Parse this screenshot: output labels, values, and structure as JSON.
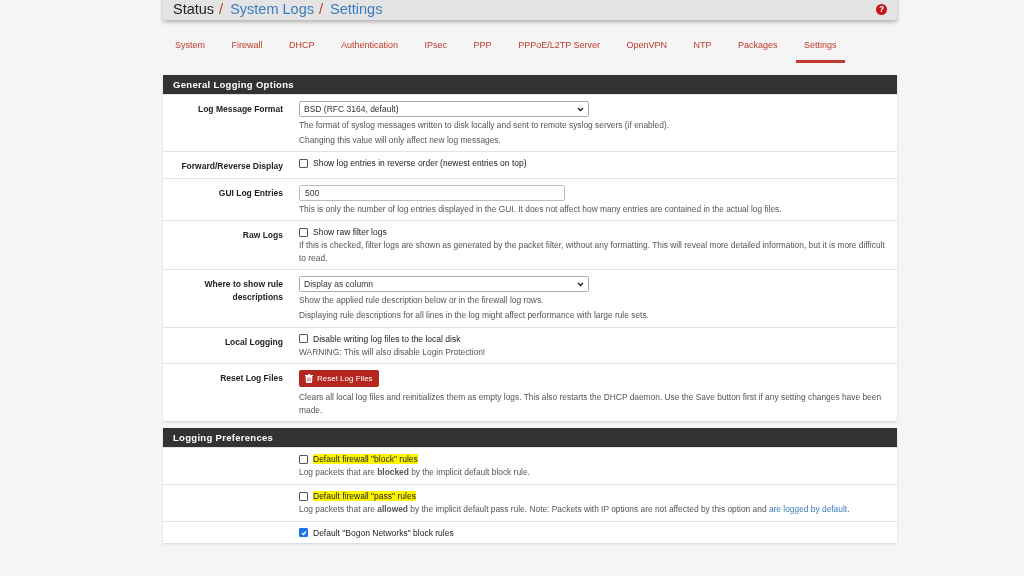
{
  "breadcrumb": {
    "items": [
      {
        "text": "Status",
        "link": false
      },
      {
        "text": "System Logs",
        "link": true
      },
      {
        "text": "Settings",
        "link": true
      }
    ],
    "separator": "/",
    "help": "?"
  },
  "tabs": [
    {
      "label": "System",
      "selected": false
    },
    {
      "label": "Firewall",
      "selected": false
    },
    {
      "label": "DHCP",
      "selected": false
    },
    {
      "label": "Authentication",
      "selected": false
    },
    {
      "label": "IPsec",
      "selected": false
    },
    {
      "label": "PPP",
      "selected": false
    },
    {
      "label": "PPPoE/L2TP Server",
      "selected": false
    },
    {
      "label": "OpenVPN",
      "selected": false
    },
    {
      "label": "NTP",
      "selected": false
    },
    {
      "label": "Packages",
      "selected": false
    },
    {
      "label": "Settings",
      "selected": true
    }
  ],
  "panels": [
    {
      "title": "General Logging Options",
      "rows": [
        {
          "label": "Log Message Format",
          "kind": "select",
          "value": "BSD (RFC 3164, default)",
          "help": [
            {
              "text": "The format of syslog messages written to disk locally and sent to remote syslog servers (if enabled)."
            },
            {
              "text": "Changing this value will only affect new log messages."
            }
          ]
        },
        {
          "label": "Forward/Reverse Display",
          "kind": "checkbox",
          "checked": false,
          "highlighted": false,
          "text": "Show log entries in reverse order (newest entries on top)",
          "help": []
        },
        {
          "label": "GUI Log Entries",
          "kind": "input",
          "value": "500",
          "help": [
            {
              "text": "This is only the number of log entries displayed in the GUI. It does not affect how many entries are contained in the actual log files."
            }
          ]
        },
        {
          "label": "Raw Logs",
          "kind": "checkbox",
          "checked": false,
          "highlighted": false,
          "text": "Show raw filter logs",
          "help": [
            {
              "text": "If this is checked, filter logs are shown as generated by the packet filter, without any formatting. This will reveal more detailed information, but it is more difficult to read."
            }
          ]
        },
        {
          "label": "Where to show rule descriptions",
          "kind": "select",
          "value": "Display as column",
          "help": [
            {
              "text": "Show the applied rule description below or in the firewall log rows."
            },
            {
              "text": "Displaying rule descriptions for all lines in the log might affect performance with large rule sets."
            }
          ]
        },
        {
          "label": "Local Logging",
          "kind": "checkbox",
          "checked": false,
          "highlighted": false,
          "text": "Disable writing log files to the local disk",
          "help": [
            {
              "text": "WARNING: This will also disable Login Protection!"
            }
          ]
        },
        {
          "label": "Reset Log Files",
          "kind": "button",
          "text": "Reset Log Files",
          "help": [
            {
              "text": "Clears all local log files and reinitializes them as empty logs. This also restarts the DHCP daemon. Use the Save button first if any setting changes have been made."
            }
          ]
        }
      ]
    },
    {
      "title": "Logging Preferences",
      "rows": [
        {
          "label": "",
          "kind": "checkbox",
          "checked": false,
          "highlighted": true,
          "text": "Default firewall \"block\" rules",
          "help": [
            {
              "text": "Log packets that are **blocked** by the implicit default block rule."
            }
          ]
        },
        {
          "label": "",
          "kind": "checkbox",
          "checked": false,
          "highlighted": true,
          "text": "Default firewall \"pass\" rules",
          "help": [
            {
              "text": "Log packets that are **allowed** by the implicit default pass rule. Note: Packets with IP options are not affected by this option and ",
              "link": "are logged by default",
              "after": "."
            }
          ]
        },
        {
          "label": "",
          "kind": "checkbox",
          "checked": true,
          "highlighted": false,
          "text": "Default \"Bogon Networks\" block rules",
          "help": []
        }
      ]
    }
  ]
}
